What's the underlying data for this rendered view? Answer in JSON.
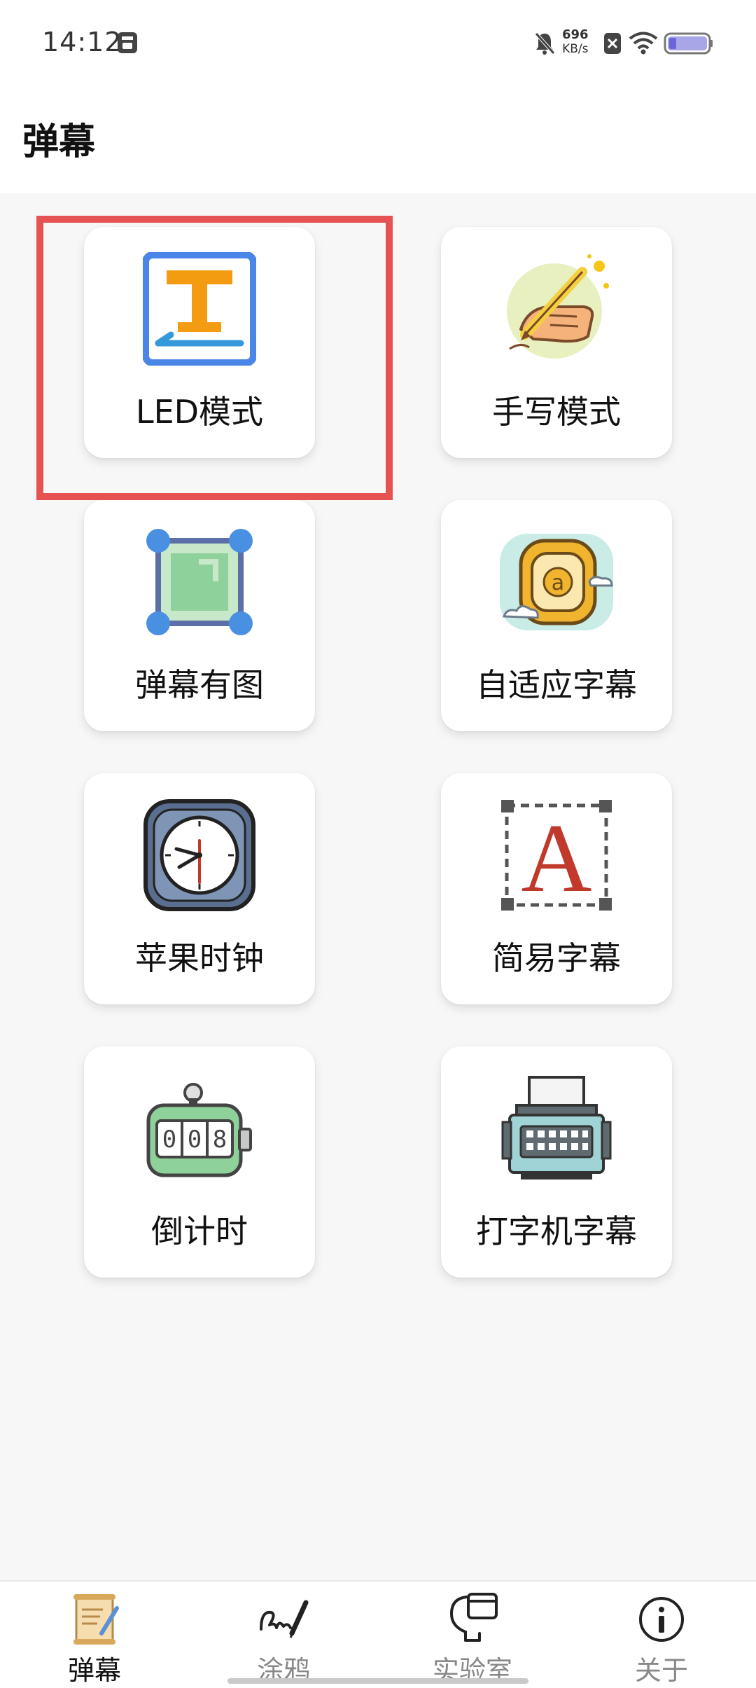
{
  "status_bar": {
    "time": "14:12",
    "net_speed_value": "696",
    "net_speed_unit": "KB/s",
    "icons": [
      "sim-card-icon",
      "mute-bell-icon",
      "no-sim-icon",
      "wifi-icon",
      "battery-icon"
    ]
  },
  "header": {
    "title": "弹幕"
  },
  "features": [
    {
      "label": "LED模式",
      "icon": "led-text-icon"
    },
    {
      "label": "手写模式",
      "icon": "handwriting-icon"
    },
    {
      "label": "弹幕有图",
      "icon": "image-frame-icon"
    },
    {
      "label": "自适应字幕",
      "icon": "adaptive-subtitle-icon"
    },
    {
      "label": "苹果时钟",
      "icon": "clock-icon"
    },
    {
      "label": "简易字幕",
      "icon": "simple-subtitle-icon"
    },
    {
      "label": "倒计时",
      "icon": "countdown-icon"
    },
    {
      "label": "打字机字幕",
      "icon": "typewriter-icon"
    }
  ],
  "highlight_color": "#e65252",
  "bottom_nav": [
    {
      "label": "弹幕",
      "icon": "scroll-icon",
      "active": true
    },
    {
      "label": "涂鸦",
      "icon": "signature-pen-icon",
      "active": false
    },
    {
      "label": "实验室",
      "icon": "lightbulb-window-icon",
      "active": false
    },
    {
      "label": "关于",
      "icon": "info-icon",
      "active": false
    }
  ]
}
